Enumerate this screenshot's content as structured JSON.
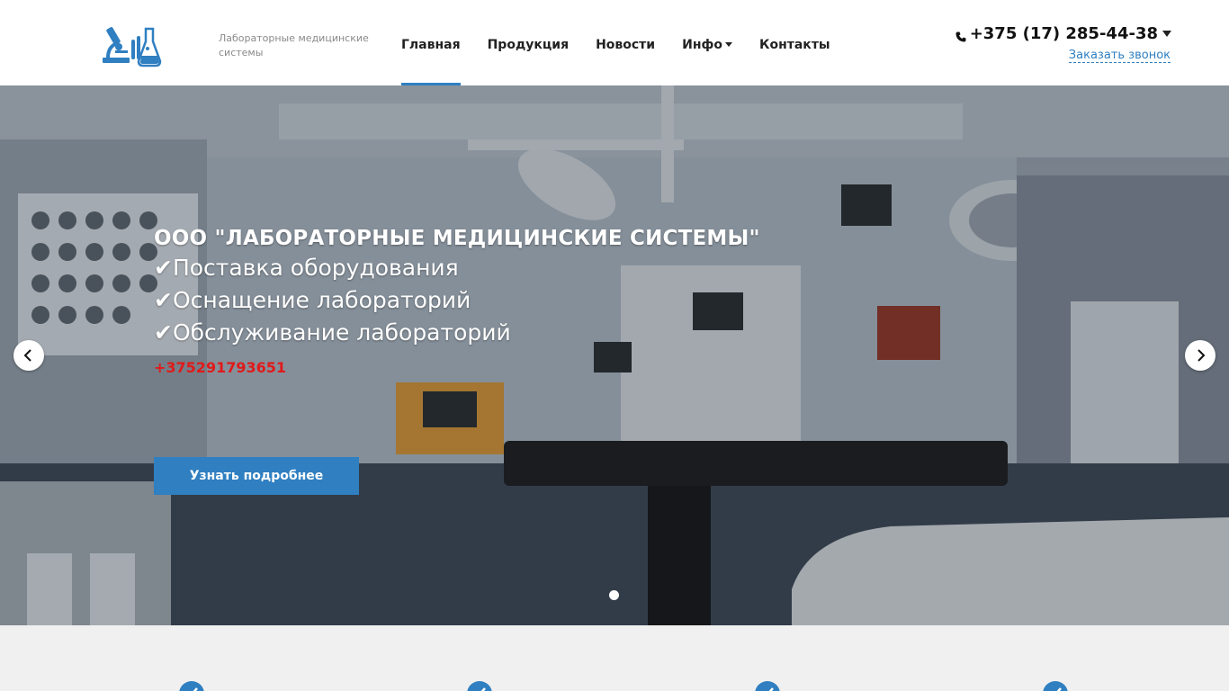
{
  "header": {
    "logo_icon": "microscope-flask-logo-icon",
    "tagline": "Лабораторные медицинские системы",
    "nav": [
      {
        "label": "Главная",
        "active": true
      },
      {
        "label": "Продукция",
        "active": false
      },
      {
        "label": "Новости",
        "active": false
      },
      {
        "label": "Инфо",
        "active": false,
        "dropdown": true
      },
      {
        "label": "Контакты",
        "active": false
      }
    ],
    "phone": "+375 (17) 285-44-38",
    "phone_icon": "phone-icon",
    "callback_label": "Заказать звонок"
  },
  "hero": {
    "title": "ООО \"ЛАБОРАТОРНЫЕ МЕДИЦИНСКИЕ СИСТЕМЫ\"",
    "lines": [
      "✔Поставка оборудования",
      "✔Оснащение лабораторий",
      "✔Обслуживание лабораторий"
    ],
    "phone": "+375291793651",
    "button_label": "Узнать подробнее",
    "prev_icon": "chevron-left-icon",
    "next_icon": "chevron-right-icon",
    "slides_count": 1,
    "active_slide": 1
  },
  "features": {
    "icons": [
      "check-icon",
      "check-icon",
      "check-icon",
      "check-icon"
    ]
  },
  "colors": {
    "accent": "#2f7fc1",
    "hero_phone": "#e01a1a",
    "features_bg": "#f0f0f0"
  }
}
